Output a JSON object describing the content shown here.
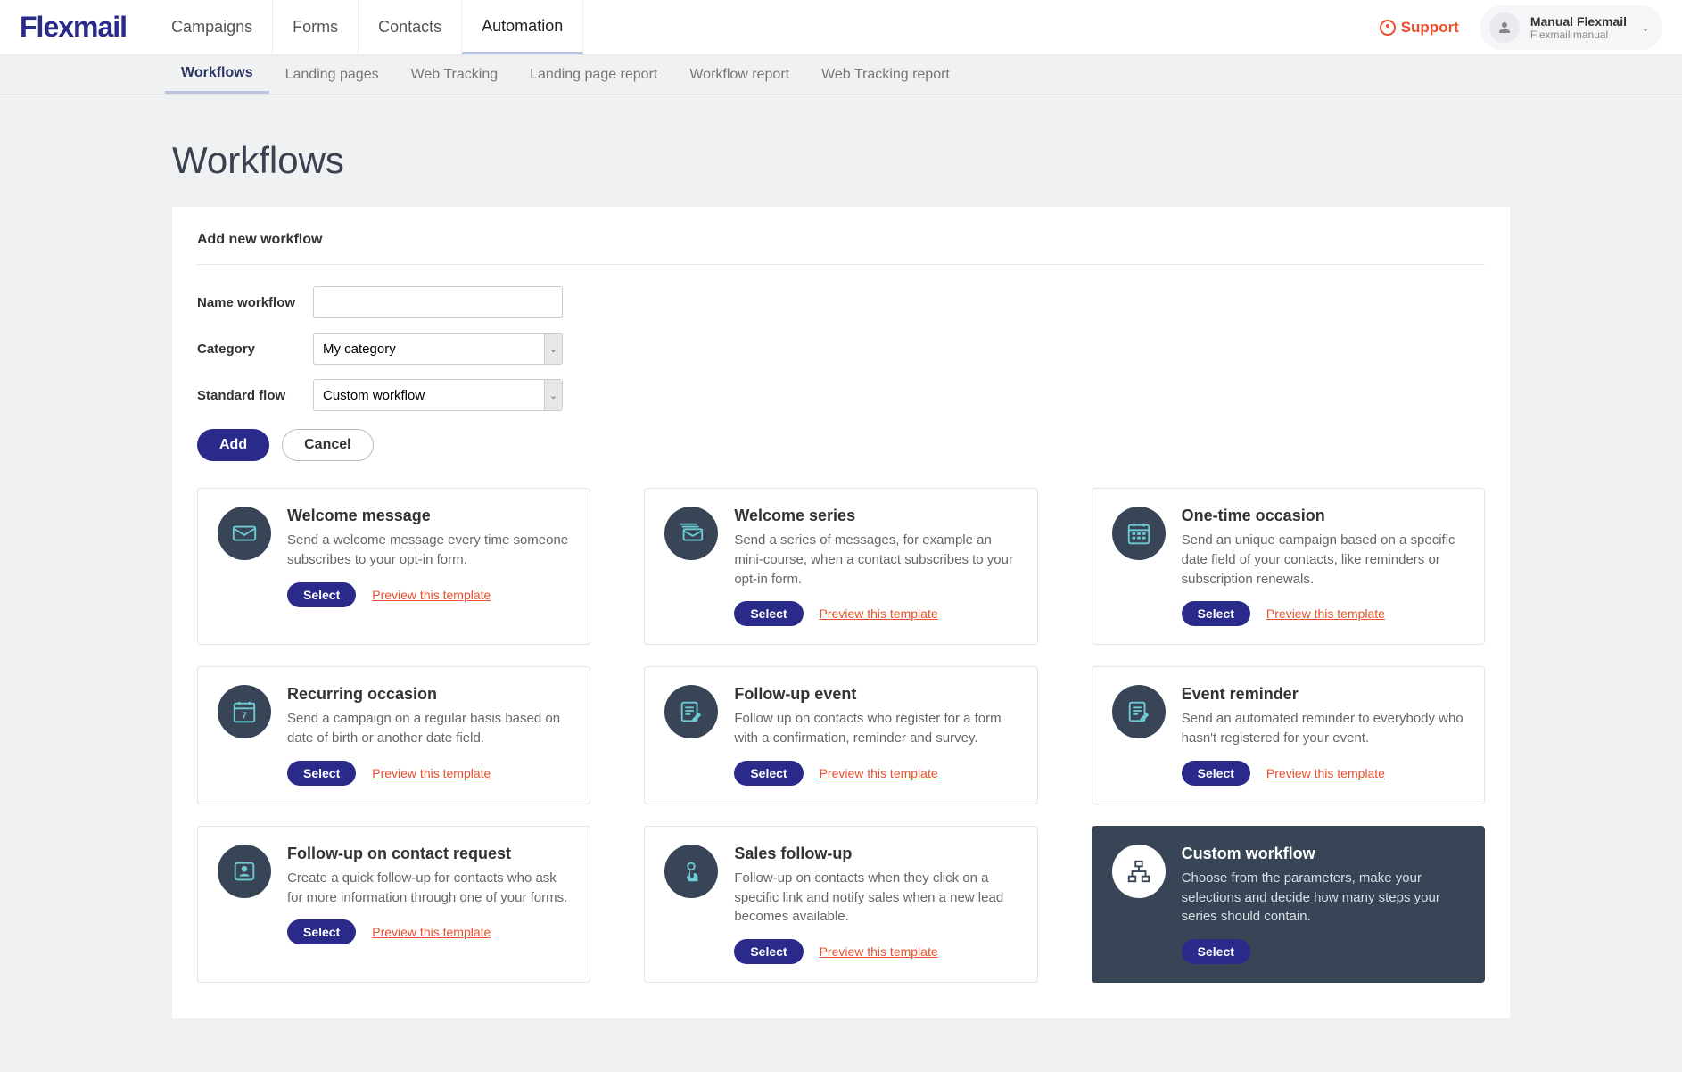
{
  "brand": "Flexmail",
  "mainnav": [
    {
      "label": "Campaigns",
      "active": false
    },
    {
      "label": "Forms",
      "active": false
    },
    {
      "label": "Contacts",
      "active": false
    },
    {
      "label": "Automation",
      "active": true
    }
  ],
  "support_label": "Support",
  "profile": {
    "name": "Manual Flexmail",
    "sub": "Flexmail manual"
  },
  "subnav": [
    {
      "label": "Workflows",
      "active": true
    },
    {
      "label": "Landing pages",
      "active": false
    },
    {
      "label": "Web Tracking",
      "active": false
    },
    {
      "label": "Landing page report",
      "active": false
    },
    {
      "label": "Workflow report",
      "active": false
    },
    {
      "label": "Web Tracking report",
      "active": false
    }
  ],
  "page_title": "Workflows",
  "panel_title": "Add new workflow",
  "form": {
    "name_label": "Name workflow",
    "name_value": "",
    "category_label": "Category",
    "category_value": "My category",
    "flow_label": "Standard flow",
    "flow_value": "Custom workflow"
  },
  "buttons": {
    "add": "Add",
    "cancel": "Cancel",
    "select": "Select",
    "preview": "Preview this template"
  },
  "templates": [
    {
      "icon": "envelope",
      "title": "Welcome message",
      "desc": "Send a welcome message every time someone subscribes to your opt-in form.",
      "preview": true,
      "dark": false
    },
    {
      "icon": "envelopes",
      "title": "Welcome series",
      "desc": "Send a series of messages, for example an mini-course, when a contact subscribes to your opt-in form.",
      "preview": true,
      "dark": false
    },
    {
      "icon": "calendar-grid",
      "title": "One-time occasion",
      "desc": "Send an unique campaign based on a specific date field of your contacts, like reminders or subscription renewals.",
      "preview": true,
      "dark": false
    },
    {
      "icon": "calendar-7",
      "title": "Recurring occasion",
      "desc": "Send a campaign on a regular basis based on date of birth or another date field.",
      "preview": true,
      "dark": false
    },
    {
      "icon": "doc-pencil",
      "title": "Follow-up event",
      "desc": "Follow up on contacts who register for a form with a confirmation, reminder and survey.",
      "preview": true,
      "dark": false
    },
    {
      "icon": "doc-pencil",
      "title": "Event reminder",
      "desc": "Send an automated reminder to everybody who hasn't registered for your event.",
      "preview": true,
      "dark": false
    },
    {
      "icon": "contact-card",
      "title": "Follow-up on contact request",
      "desc": "Create a quick follow-up for contacts who ask for more information through one of your forms.",
      "preview": true,
      "dark": false
    },
    {
      "icon": "click-hand",
      "title": "Sales follow-up",
      "desc": "Follow-up on contacts when they click on a specific link and notify sales when a new lead becomes available.",
      "preview": true,
      "dark": false
    },
    {
      "icon": "flowchart",
      "title": "Custom workflow",
      "desc": "Choose from the parameters, make your selections and decide how many steps your series should contain.",
      "preview": false,
      "dark": true
    }
  ]
}
